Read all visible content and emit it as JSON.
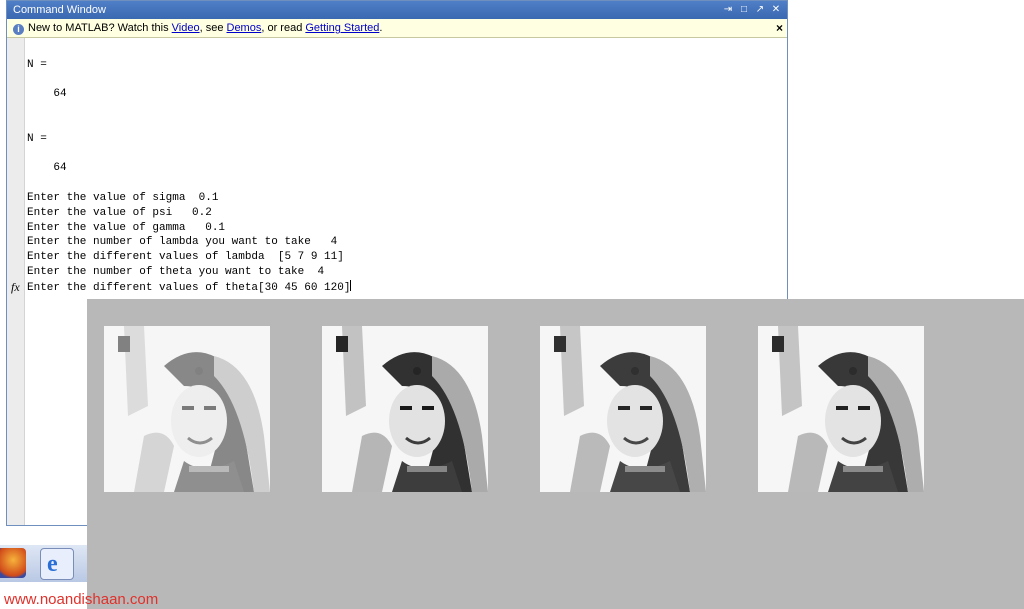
{
  "window": {
    "title": "Command Window",
    "controls": [
      "⇥",
      "□",
      "↗",
      "✕"
    ]
  },
  "infobar": {
    "prefix": "New to MATLAB? Watch this ",
    "link_video": "Video",
    "sep1": ", see ",
    "link_demos": "Demos",
    "sep2": ", or read ",
    "link_getting_started": "Getting Started",
    "suffix": ".",
    "close": "×"
  },
  "console": {
    "lines": [
      "",
      "N =",
      "",
      "    64",
      "",
      "",
      "N =",
      "",
      "    64",
      "",
      "Enter the value of sigma  0.1",
      "Enter the value of psi   0.2",
      "Enter the value of gamma   0.1",
      "Enter the number of lambda you want to take   4",
      "Enter the different values of lambda  [5 7 9 11]",
      "Enter the number of theta you want to take  4",
      "Enter the different values of theta[30 45 60 120]"
    ],
    "prompt_icon": "fx"
  },
  "figure": {
    "images": [
      "filtered-portrait-1",
      "filtered-portrait-2",
      "filtered-portrait-3",
      "filtered-portrait-4"
    ]
  },
  "taskbar": {
    "icons": [
      "firefox-icon",
      "internet-explorer-icon"
    ]
  },
  "watermark": "www.noandishaan.com",
  "colors": {
    "titlebar": "#3a68b1",
    "infobar_bg": "#ffffe1",
    "figure_bg": "#b8b8b8",
    "watermark": "#e0312b"
  }
}
